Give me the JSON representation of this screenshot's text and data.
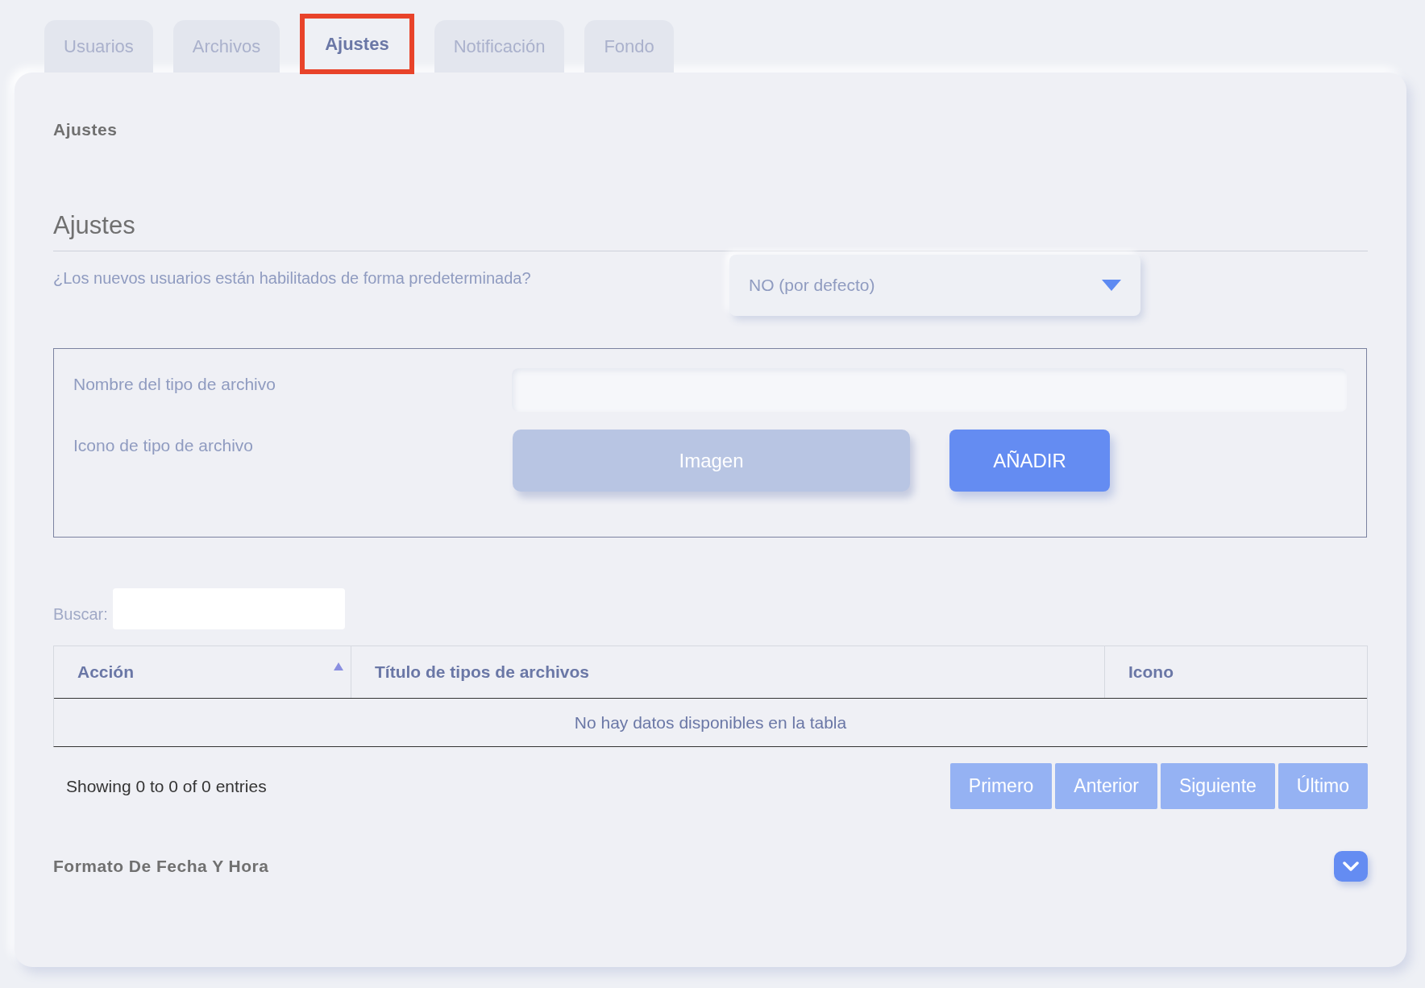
{
  "tabs": [
    {
      "label": "Usuarios",
      "selected": false
    },
    {
      "label": "Archivos",
      "selected": false
    },
    {
      "label": "Ajustes",
      "selected": true
    },
    {
      "label": "Notificación",
      "selected": false
    },
    {
      "label": "Fondo",
      "selected": false
    }
  ],
  "panel_title": "Ajustes",
  "section": {
    "heading": "Ajustes",
    "question": "¿Los nuevos usuarios están habilitados de forma predeterminada?",
    "select_value": "NO (por defecto)"
  },
  "file_type_form": {
    "name_label": "Nombre del tipo de archivo",
    "icon_label": "Icono de tipo de archivo",
    "image_button": "Imagen",
    "add_button": "AÑADIR"
  },
  "search": {
    "label": "Buscar:"
  },
  "table": {
    "columns": [
      {
        "label": "Acción",
        "sorted": true
      },
      {
        "label": "Título de tipos de archivos",
        "sorted": false
      },
      {
        "label": "Icono",
        "sorted": false
      }
    ],
    "empty_message": "No hay datos disponibles en la tabla"
  },
  "info": "Showing 0 to 0 of 0 entries",
  "pagination": [
    "Primero",
    "Anterior",
    "Siguiente",
    "Último"
  ],
  "collapsible": {
    "title": "Formato De Fecha Y Hora",
    "expanded": false
  }
}
